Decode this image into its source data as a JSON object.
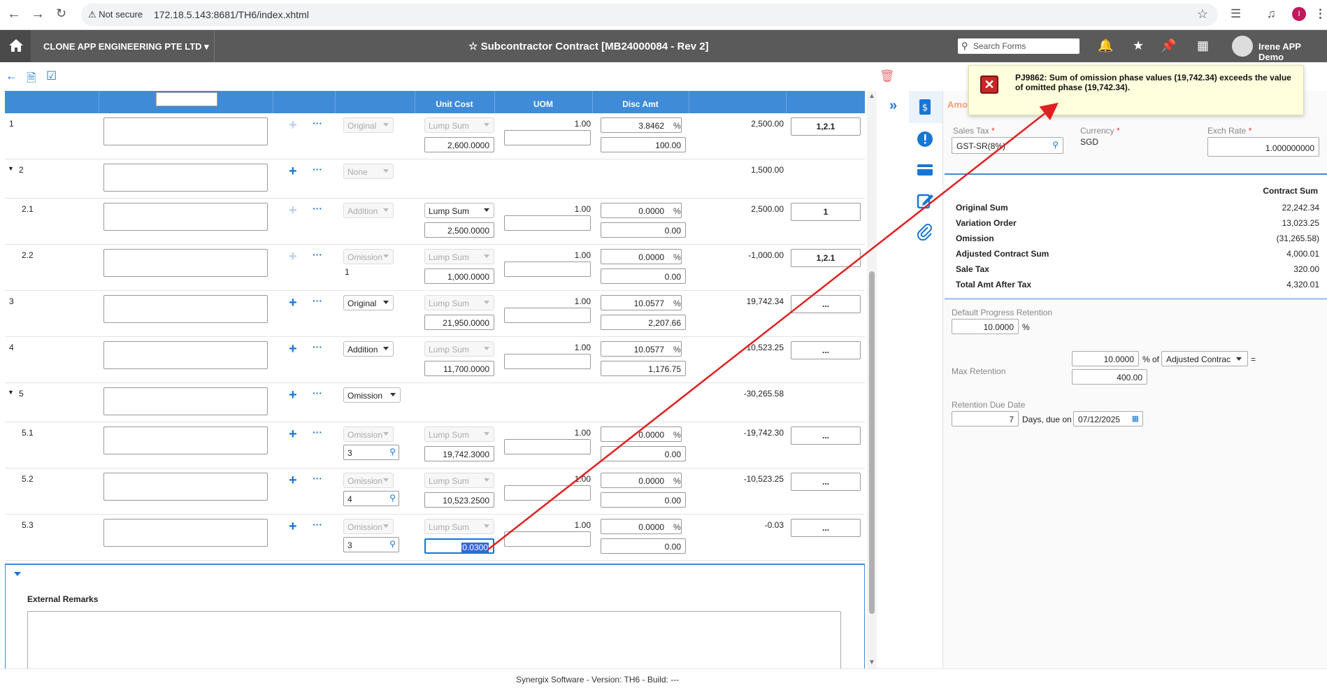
{
  "browser": {
    "not_secure": "Not secure",
    "url": "172.18.5.143:8681/TH6/index.xhtml",
    "profile_initial": "I"
  },
  "app": {
    "company": "CLONE APP ENGINEERING PTE LTD",
    "title": "Subcontractor Contract [MB24000084 - Rev 2]",
    "search_placeholder": "Search Forms",
    "user": "Irene APP Demo"
  },
  "grid": {
    "headers": [
      "Unit Cost",
      "UOM",
      "Disc Amt"
    ],
    "rows": [
      {
        "no": "1",
        "phase_type": "Original",
        "phase_disabled": true,
        "cost_type": "Lump Sum",
        "cost_disabled": true,
        "qty": "1.00",
        "unit_cost": "2,600.0000",
        "disc_pct": "3.8462",
        "disc_amt": "100.00",
        "amount": "2,500.00",
        "ref": "1,2.1",
        "plus_disabled": true
      },
      {
        "no": "2",
        "phase_type": "None",
        "phase_disabled": true,
        "amount": "1,500.00",
        "group": true
      },
      {
        "no": "2.1",
        "phase_type": "Addition",
        "phase_disabled": true,
        "cost_type": "Lump Sum",
        "cost_disabled": false,
        "qty": "1.00",
        "unit_cost": "2,500.0000",
        "disc_pct": "0.0000",
        "disc_amt": "0.00",
        "amount": "2,500.00",
        "ref": "1",
        "plus_disabled": true
      },
      {
        "no": "2.2",
        "phase_type": "Omission",
        "phase_disabled": true,
        "phase_ref": "1",
        "cost_type": "Lump Sum",
        "cost_disabled": true,
        "qty": "1.00",
        "unit_cost": "1,000.0000",
        "disc_pct": "0.0000",
        "disc_amt": "0.00",
        "amount": "-1,000.00",
        "ref": "1,2.1",
        "plus_disabled": true
      },
      {
        "no": "3",
        "phase_type": "Original",
        "phase_disabled": false,
        "cost_type": "Lump Sum",
        "cost_disabled": true,
        "qty": "1.00",
        "unit_cost": "21,950.0000",
        "disc_pct": "10.0577",
        "disc_amt": "2,207.66",
        "amount": "19,742.34",
        "ref": "..."
      },
      {
        "no": "4",
        "phase_type": "Addition",
        "phase_disabled": false,
        "cost_type": "Lump Sum",
        "cost_disabled": true,
        "qty": "1.00",
        "unit_cost": "11,700.0000",
        "disc_pct": "10.0577",
        "disc_amt": "1,176.75",
        "amount": "10,523.25",
        "ref": "..."
      },
      {
        "no": "5",
        "phase_type": "Omission",
        "phase_disabled": false,
        "amount": "-30,265.58",
        "group": true
      },
      {
        "no": "5.1",
        "phase_type": "Omission",
        "phase_disabled": true,
        "phase_ref": "3",
        "cost_type": "Lump Sum",
        "cost_disabled": true,
        "qty": "1.00",
        "unit_cost": "19,742.3000",
        "disc_pct": "0.0000",
        "disc_amt": "0.00",
        "amount": "-19,742.30",
        "ref": "..."
      },
      {
        "no": "5.2",
        "phase_type": "Omission",
        "phase_disabled": true,
        "phase_ref": "4",
        "cost_type": "Lump Sum",
        "cost_disabled": true,
        "qty": "1.00",
        "unit_cost": "10,523.2500",
        "disc_pct": "0.0000",
        "disc_amt": "0.00",
        "amount": "-10,523.25",
        "ref": "..."
      },
      {
        "no": "5.3",
        "phase_type": "Omission",
        "phase_disabled": true,
        "phase_ref": "3",
        "cost_type": "Lump Sum",
        "cost_disabled": true,
        "qty": "1.00",
        "unit_cost": "0.0300",
        "disc_pct": "0.0000",
        "disc_amt": "0.00",
        "amount": "-0.03",
        "ref": "...",
        "highlight": true
      }
    ],
    "pct_symbol": "%",
    "dots": "···"
  },
  "remarks": {
    "label": "External Remarks"
  },
  "footer": "Synergix Software - Version: TH6 - Build: ---",
  "panel": {
    "tab_label": "Amo",
    "sales_tax_label": "Sales Tax",
    "sales_tax_value": "GST-SR(8%)",
    "currency_label": "Currency",
    "currency_value": "SGD",
    "exch_rate_label": "Exch Rate",
    "exch_rate_value": "1.000000000",
    "contract_sum_header": "Contract Sum",
    "summary": [
      {
        "k": "Original Sum",
        "v": "22,242.34"
      },
      {
        "k": "Variation Order",
        "v": "13,023.25"
      },
      {
        "k": "Omission",
        "v": "(31,265.58)"
      },
      {
        "k": "Adjusted Contract Sum",
        "v": "4,000.01"
      },
      {
        "k": "Sale Tax",
        "v": "320.00"
      },
      {
        "k": "Total Amt After Tax",
        "v": "4,320.01"
      }
    ],
    "default_retention_label": "Default Progress Retention",
    "default_retention_value": "10.0000",
    "pct": "%",
    "max_retention_label": "Max Retention",
    "max_retention_pct": "10.0000",
    "pct_of": "% of",
    "max_retention_basis": "Adjusted Contrac",
    "equals": "=",
    "max_retention_amount": "400.00",
    "retention_due_label": "Retention Due Date",
    "retention_due_days": "7",
    "days_due_on": "Days, due on",
    "retention_due_date": "07/12/2025"
  },
  "toast": {
    "message": "PJ9862: Sum of omission phase values (19,742.34) exceeds the value of omitted phase (19,742.34)."
  }
}
